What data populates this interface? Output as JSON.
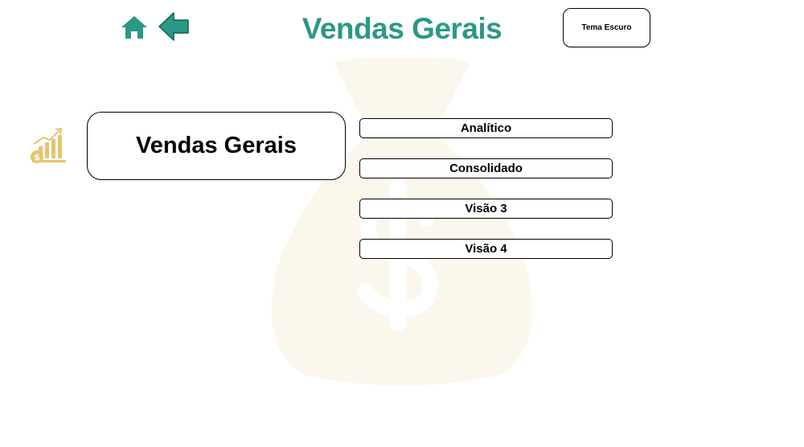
{
  "header": {
    "title": "Vendas Gerais",
    "theme_button_label": "Tema Escuro"
  },
  "main": {
    "card_title": "Vendas Gerais",
    "nav_buttons": [
      {
        "label": "Analítico"
      },
      {
        "label": "Consolidado"
      },
      {
        "label": "Visão 3"
      },
      {
        "label": "Visão 4"
      }
    ]
  },
  "icons": {
    "home": "home-icon",
    "back": "back-arrow-icon",
    "sales": "sales-growth-icon",
    "background": "money-bag-icon"
  },
  "colors": {
    "accent": "#2b9886",
    "gold": "#e6c46f",
    "background_watermark": "#fbf7ec"
  }
}
